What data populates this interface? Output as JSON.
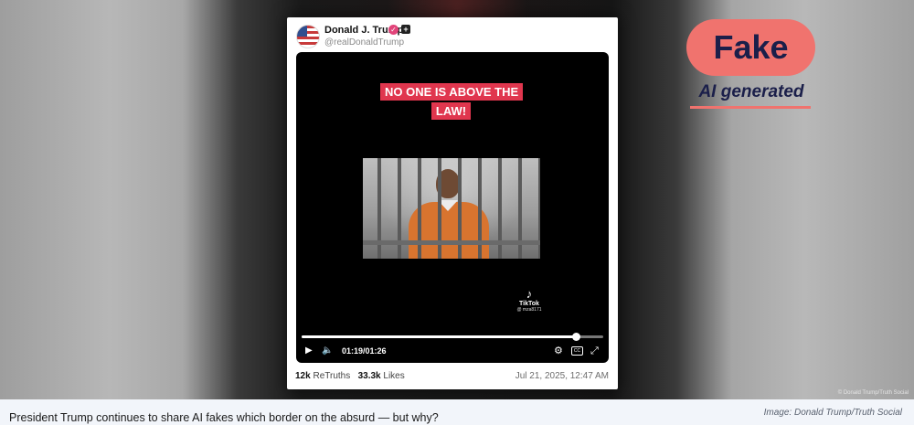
{
  "post": {
    "author_name": "Donald J. Trump",
    "verified_glyph": "✓",
    "badge_glyph": "+",
    "handle": "@realDonaldTrump",
    "video": {
      "caption_overlay": "NO ONE IS ABOVE THE LAW!",
      "watermark": {
        "icon_glyph": "♪",
        "label": "TikTok",
        "handle": "@ mza8171"
      },
      "controls": {
        "play_glyph": "▶",
        "volume_glyph": "🔈",
        "time": "01:19/01:26",
        "settings_glyph": "⚙",
        "captions_glyph": "CC",
        "fullscreen_glyph": "⤢",
        "progress_fraction": 0.91
      }
    },
    "stats": {
      "retruths_count": "12k",
      "retruths_label": "ReTruths",
      "likes_count": "33.3k",
      "likes_label": "Likes"
    },
    "timestamp": "Jul 21, 2025, 12:47 AM"
  },
  "label": {
    "badge_text": "Fake",
    "subtext": "AI generated",
    "badge_color": "#f0736e",
    "text_color": "#1b1f4a"
  },
  "overlay_credit": "© Donald Trump/Truth Social",
  "caption": {
    "text": "President Trump continues to share AI fakes which border on the absurd — but why?",
    "credit": "Image: Donald Trump/Truth Social"
  }
}
